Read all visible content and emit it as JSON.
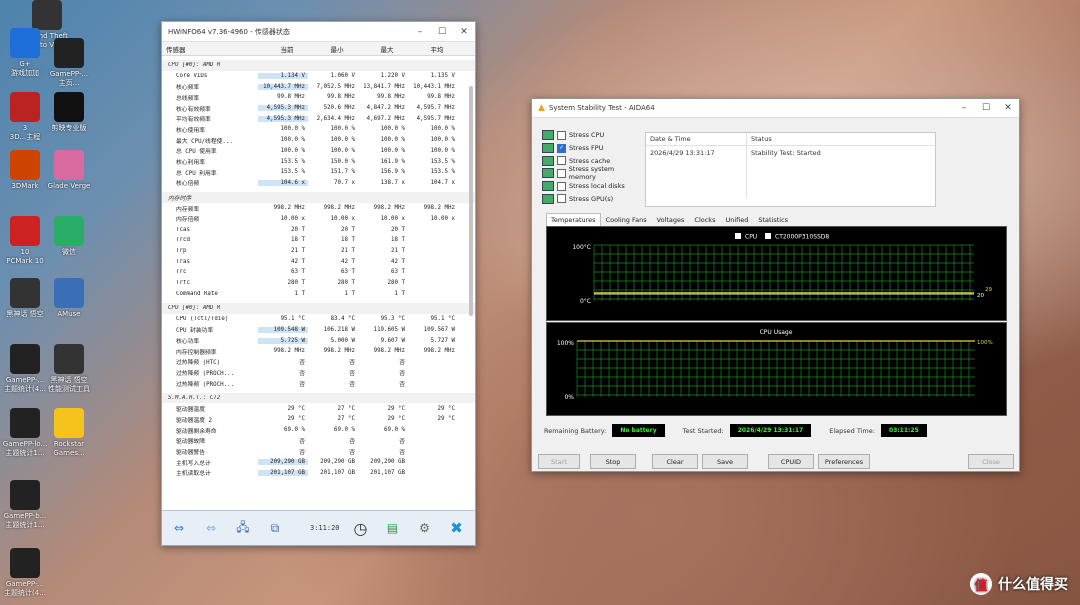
{
  "desktop": {
    "icons": [
      {
        "label": "Grand Theft Auto V 免",
        "color": "#333"
      },
      {
        "label": "G+",
        "sublabel": "游戏加加",
        "color": "#1e6fd9"
      },
      {
        "label": "GamePP-...",
        "sublabel": "主页...",
        "color": "#222"
      },
      {
        "label": "3",
        "sublabel": "3D...主程",
        "color": "#b22"
      },
      {
        "label": "剪映专业版",
        "color": "#111"
      },
      {
        "label": "3DMark",
        "color": "#c40"
      },
      {
        "label": "Glade Verge",
        "color": "#d96aa0"
      },
      {
        "label": "10",
        "sublabel": "PCMark 10",
        "color": "#c22"
      },
      {
        "label": "微信",
        "color": "#2aae67"
      },
      {
        "label": "黑神话 悟空",
        "color": "#333"
      },
      {
        "label": "AMuse",
        "color": "#3a6fb8"
      },
      {
        "label": "GamePP-...",
        "sublabel": "主题统计(4...",
        "color": "#222"
      },
      {
        "label": "黑神话 悟空",
        "sublabel": "性能测试工具",
        "color": "#333"
      },
      {
        "label": "GamePP-lo...",
        "sublabel": "主题统计1...",
        "color": "#222"
      },
      {
        "label": "Rockstar Games...",
        "color": "#f6c21c"
      },
      {
        "label": "GamePP-b...",
        "sublabel": "主题统计1...",
        "color": "#222"
      },
      {
        "label": "GamePP-...",
        "sublabel": "主题统计(4...",
        "color": "#222"
      }
    ]
  },
  "hwinfo": {
    "title": "HWiNFO64 v7.36-4960 - 传感器状态",
    "columns": [
      "传感器",
      "当前",
      "最小",
      "最大",
      "平均"
    ],
    "groups": [
      {
        "name": "CPU [#0]: AMD R",
        "rows": [
          {
            "name": "Core VIDs",
            "vals": [
              "1.134 V",
              "1.060 V",
              "1.220 V",
              "1.135 V"
            ],
            "hl": true
          },
          {
            "name": "核心频率",
            "vals": [
              "10,443.7 MHz",
              "7,052.5 MHz",
              "13,841.7 MHz",
              "10,443.1 MHz"
            ],
            "hl": true
          },
          {
            "name": "总线频率",
            "vals": [
              "99.8 MHz",
              "99.8 MHz",
              "99.8 MHz",
              "99.8 MHz"
            ],
            "hl": false
          },
          {
            "name": "核心有效频率",
            "vals": [
              "4,595.3 MHz",
              "520.6 MHz",
              "4,847.2 MHz",
              "4,595.7 MHz"
            ],
            "hl": true
          },
          {
            "name": "平均有效频率",
            "vals": [
              "4,595.3 MHz",
              "2,634.4 MHz",
              "4,697.2 MHz",
              "4,595.7 MHz"
            ],
            "hl": true
          },
          {
            "name": "核心使用率",
            "vals": [
              "100.0 %",
              "100.0 %",
              "100.0 %",
              "100.0 %"
            ],
            "hl": false
          },
          {
            "name": "最大 CPU/线程使...",
            "vals": [
              "100.0 %",
              "100.0 %",
              "100.0 %",
              "100.0 %"
            ],
            "hl": false
          },
          {
            "name": "总 CPU 使用率",
            "vals": [
              "100.0 %",
              "100.0 %",
              "100.0 %",
              "100.0 %"
            ],
            "hl": false
          },
          {
            "name": "核心利用率",
            "vals": [
              "153.5 %",
              "150.0 %",
              "161.9 %",
              "153.5 %"
            ],
            "hl": false
          },
          {
            "name": "总 CPU 利用率",
            "vals": [
              "153.5 %",
              "151.7 %",
              "156.9 %",
              "153.5 %"
            ],
            "hl": false
          },
          {
            "name": "核心倍频",
            "vals": [
              "104.6 x",
              "70.7 x",
              "138.7 x",
              "104.7 x"
            ],
            "hl": true
          }
        ]
      },
      {
        "name": "内存时序",
        "rows": [
          {
            "name": "内存频率",
            "vals": [
              "998.2 MHz",
              "998.2 MHz",
              "998.2 MHz",
              "998.2 MHz"
            ],
            "hl": false
          },
          {
            "name": "内存倍频",
            "vals": [
              "10.00 x",
              "10.00 x",
              "10.00 x",
              "10.00 x"
            ],
            "hl": false
          },
          {
            "name": "Tcas",
            "vals": [
              "20 T",
              "20 T",
              "20 T",
              ""
            ],
            "hl": false
          },
          {
            "name": "Trcd",
            "vals": [
              "18 T",
              "18 T",
              "18 T",
              ""
            ],
            "hl": false
          },
          {
            "name": "Trp",
            "vals": [
              "21 T",
              "21 T",
              "21 T",
              ""
            ],
            "hl": false
          },
          {
            "name": "Tras",
            "vals": [
              "42 T",
              "42 T",
              "42 T",
              ""
            ],
            "hl": false
          },
          {
            "name": "Trc",
            "vals": [
              "63 T",
              "63 T",
              "63 T",
              ""
            ],
            "hl": false
          },
          {
            "name": "Trfc",
            "vals": [
              "280 T",
              "280 T",
              "280 T",
              ""
            ],
            "hl": false
          },
          {
            "name": "Command Rate",
            "vals": [
              "1 T",
              "1 T",
              "1 T",
              ""
            ],
            "hl": false
          }
        ]
      },
      {
        "name": "CPU [#0]: AMD R",
        "rows": [
          {
            "name": "CPU (Tctl/Tdie)",
            "vals": [
              "95.1 °C",
              "83.4 °C",
              "95.3 °C",
              "95.1 °C"
            ],
            "hl": false
          },
          {
            "name": "CPU 封装功率",
            "vals": [
              "109.548 W",
              "106.218 W",
              "119.605 W",
              "109.567 W"
            ],
            "hl": true
          },
          {
            "name": "核心功率",
            "vals": [
              "5.725 W",
              "5.000 W",
              "9.607 W",
              "5.727 W"
            ],
            "hl": true
          },
          {
            "name": "内存控制器频率",
            "vals": [
              "998.2 MHz",
              "998.2 MHz",
              "998.2 MHz",
              "998.2 MHz"
            ],
            "hl": false
          },
          {
            "name": "过热降频 (HTC)",
            "vals": [
              "否",
              "否",
              "否",
              ""
            ],
            "hl": false
          },
          {
            "name": "过热降频 (PROCH...",
            "vals": [
              "否",
              "否",
              "否",
              ""
            ],
            "hl": false
          },
          {
            "name": "过热降频 (PROCH...",
            "vals": [
              "否",
              "否",
              "否",
              ""
            ],
            "hl": false
          }
        ]
      },
      {
        "name": "S.M.A.R.T.: CT2",
        "rows": [
          {
            "name": "驱动器温度",
            "vals": [
              "29 °C",
              "27 °C",
              "29 °C",
              "29 °C"
            ],
            "hl": false
          },
          {
            "name": "驱动器温度 2",
            "vals": [
              "29 °C",
              "27 °C",
              "29 °C",
              "29 °C"
            ],
            "hl": false
          },
          {
            "name": "驱动器剩余寿命",
            "vals": [
              "69.0 %",
              "69.0 %",
              "69.0 %",
              ""
            ],
            "hl": false
          },
          {
            "name": "驱动器故障",
            "vals": [
              "否",
              "否",
              "否",
              ""
            ],
            "hl": false
          },
          {
            "name": "驱动器警告",
            "vals": [
              "否",
              "否",
              "否",
              ""
            ],
            "hl": false
          },
          {
            "name": "主机写入总计",
            "vals": [
              "209,290 GB",
              "209,290 GB",
              "209,290 GB",
              ""
            ],
            "hl": true
          },
          {
            "name": "主机读取总计",
            "vals": [
              "201,107 GB",
              "201,107 GB",
              "201,107 GB",
              ""
            ],
            "hl": true
          }
        ]
      }
    ],
    "timer": "3:11:20"
  },
  "aida": {
    "title": "System Stability Test - AIDA64",
    "stress": [
      {
        "label": "Stress CPU",
        "checked": false
      },
      {
        "label": "Stress FPU",
        "checked": true
      },
      {
        "label": "Stress cache",
        "checked": false
      },
      {
        "label": "Stress system memory",
        "checked": false
      },
      {
        "label": "Stress local disks",
        "checked": false
      },
      {
        "label": "Stress GPU(s)",
        "checked": false
      }
    ],
    "table": {
      "col1": "Date & Time",
      "col2": "Status",
      "row_date": "2026/4/29 13:31:17",
      "row_status": "Stability Test: Started"
    },
    "tabs": [
      "Temperatures",
      "Cooling Fans",
      "Voltages",
      "Clocks",
      "Unified",
      "Statistics"
    ],
    "temp_graph": {
      "legend_cpu": "CPU",
      "legend_disk": "CT2000P310SSD8",
      "y_top": "100°C",
      "y_bottom": "0°C",
      "val_a": "29",
      "val_b": "20",
      "cpu_temp_fraction": 0.0,
      "disk_temp_fraction": 0.29
    },
    "usage_graph": {
      "title": "CPU Usage",
      "y_top": "100%",
      "y_bottom": "0%",
      "val": "100%",
      "usage_fraction": 1.0
    },
    "status": {
      "battery_label": "Remaining Battery:",
      "battery_value": "No battery",
      "started_label": "Test Started:",
      "started_value": "2026/4/29 13:31:17",
      "elapsed_label": "Elapsed Time:",
      "elapsed_value": "03:11:25"
    },
    "buttons": {
      "start": "Start",
      "stop": "Stop",
      "clear": "Clear",
      "save": "Save",
      "cpuid": "CPUID",
      "prefs": "Preferences",
      "close": "Close"
    }
  },
  "watermark": {
    "text": "什么值得买",
    "logo": "值"
  }
}
